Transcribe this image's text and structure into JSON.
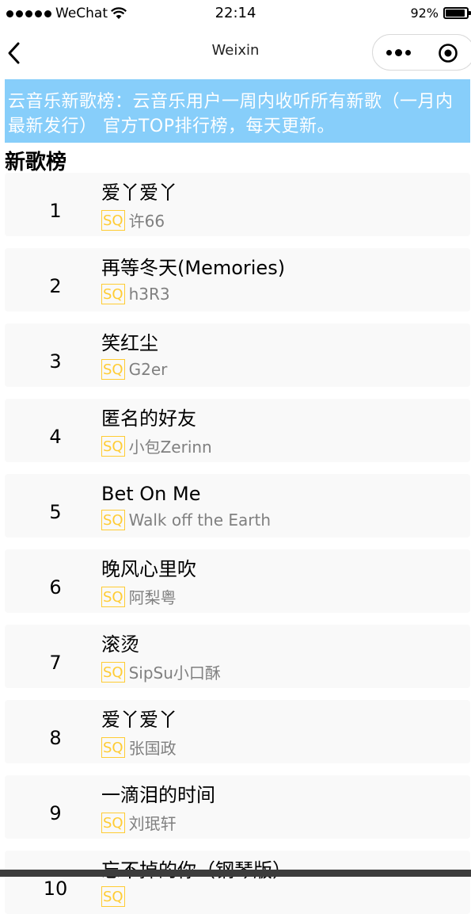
{
  "status_bar": {
    "carrier": "WeChat",
    "time": "22:14",
    "battery": "92%",
    "battery_level": 0.92
  },
  "nav": {
    "title": "Weixin",
    "icons": {
      "back": "chevron-left-icon",
      "more": "more-dots-icon",
      "close": "target-circle-icon"
    }
  },
  "banner": {
    "text": "云音乐新歌榜：云音乐用户一周内收听所有新歌（一月内最新发行） 官方TOP排行榜，每天更新。"
  },
  "section": {
    "title": "新歌榜"
  },
  "badge_label": "SQ",
  "colors": {
    "banner_bg": "#87cefa",
    "badge": "#ffcc33",
    "artist": "#808080",
    "card_bg": "#f9f9f9"
  },
  "songs": [
    {
      "rank": "1",
      "name": "爱丫爱丫",
      "artist": "许66"
    },
    {
      "rank": "2",
      "name": "再等冬天(Memories)",
      "artist": "h3R3"
    },
    {
      "rank": "3",
      "name": "笑红尘",
      "artist": "G2er"
    },
    {
      "rank": "4",
      "name": "匿名的好友",
      "artist": "小包Zerinn"
    },
    {
      "rank": "5",
      "name": "Bet On Me",
      "artist": "Walk off the Earth"
    },
    {
      "rank": "6",
      "name": "晚风心里吹",
      "artist": "阿梨粤"
    },
    {
      "rank": "7",
      "name": "滚烫",
      "artist": "SipSu小口酥"
    },
    {
      "rank": "8",
      "name": "爱丫爱丫",
      "artist": "张国政"
    },
    {
      "rank": "9",
      "name": "一滴泪的时间",
      "artist": "刘珉轩"
    },
    {
      "rank": "10",
      "name": "忘不掉的你（钢琴版）",
      "artist": ""
    }
  ]
}
